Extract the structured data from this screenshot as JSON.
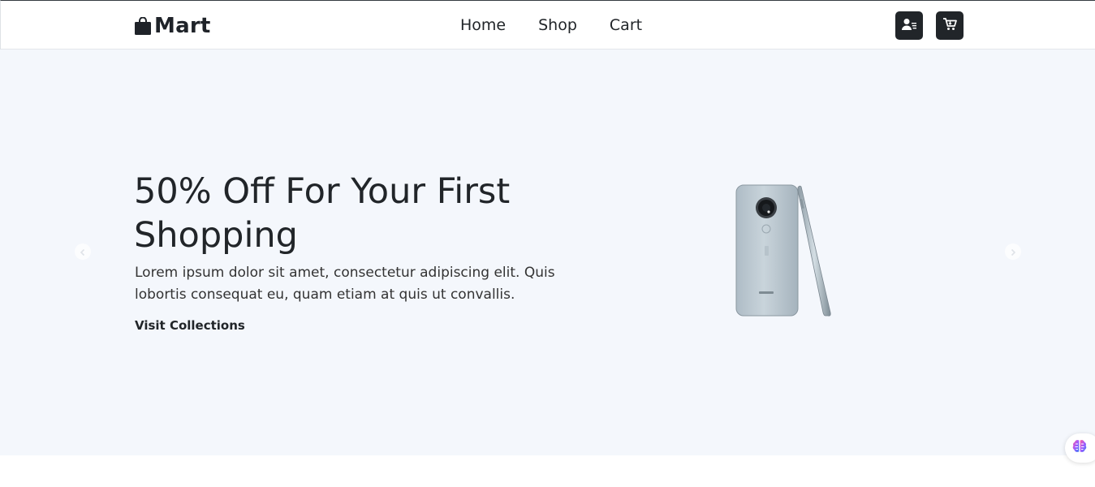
{
  "navbar": {
    "brand": "Mart",
    "brand_icon": "shopping-bag-icon",
    "links": [
      "Home",
      "Shop",
      "Cart"
    ],
    "user_icon": "user-list-icon",
    "cart_icon": "cart-icon"
  },
  "hero": {
    "title": "50% Off For Your First Shopping",
    "description": "Lorem ipsum dolor sit amet, consectetur adipiscing elit. Quis lobortis consequat eu, quam etiam at quis ut convallis.",
    "cta": "Visit Collections",
    "image": "smartphone-product-image"
  },
  "carousel": {
    "prev_icon": "chevron-left-icon",
    "next_icon": "chevron-right-icon"
  },
  "widget": {
    "icon": "brain-icon"
  },
  "colors": {
    "dark": "#212529",
    "hero_bg": "#f4f7fc",
    "white": "#ffffff"
  }
}
